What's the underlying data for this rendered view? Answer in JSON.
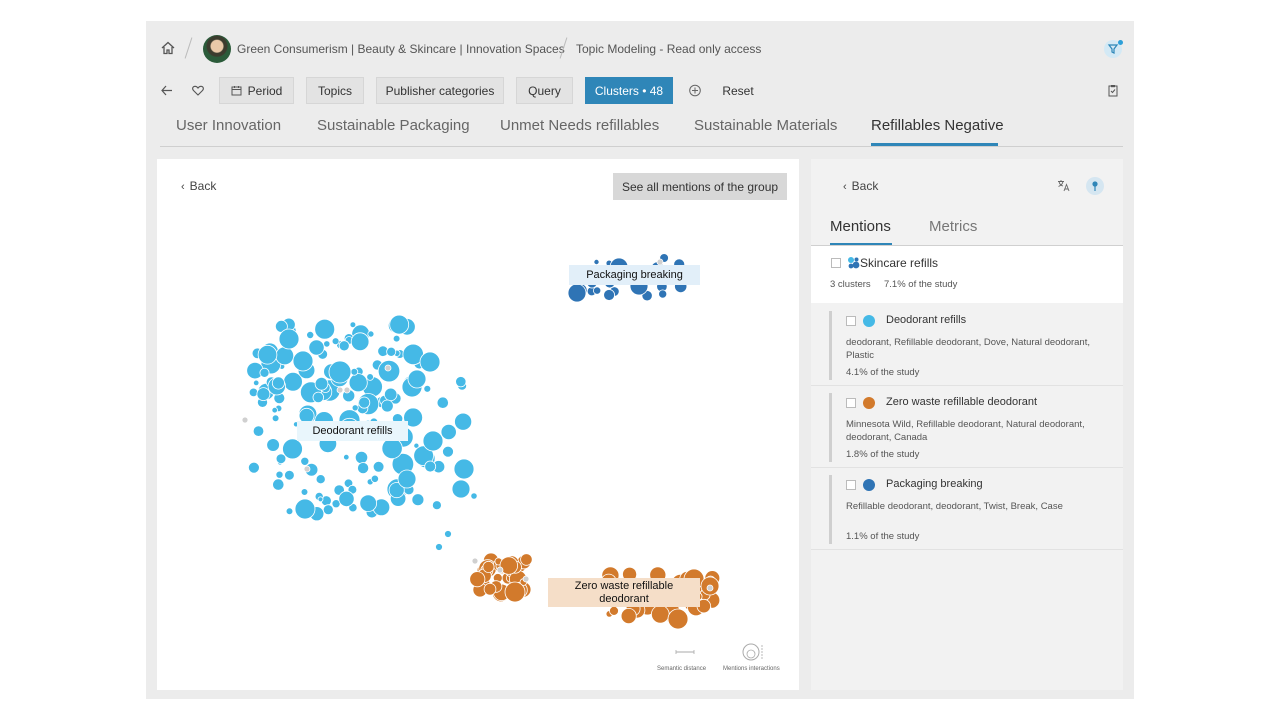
{
  "header": {
    "breadcrumb_project": "Green Consumerism | Beauty & Skincare | Innovation Spaces",
    "breadcrumb_view": "Topic Modeling - Read only access"
  },
  "toolbar": {
    "period": "Period",
    "topics": "Topics",
    "publisher_categories": "Publisher categories",
    "query": "Query",
    "clusters": "Clusters • 48",
    "reset": "Reset"
  },
  "tabs": [
    {
      "label": "User Innovation"
    },
    {
      "label": "Sustainable Packaging"
    },
    {
      "label": "Unmet Needs refillables"
    },
    {
      "label": "Sustainable Materials"
    },
    {
      "label": "Refillables Negative"
    }
  ],
  "map": {
    "back": "Back",
    "see_all": "See all mentions of the group",
    "labels": {
      "packaging": "Packaging breaking",
      "deodorant": "Deodorant refills",
      "zero_waste": "Zero waste refillable deodorant"
    },
    "legend": {
      "semantic_distance": "Semantic distance",
      "mentions_interactions": "Mentions interactions"
    },
    "colors": {
      "deodorant": "#45b9e6",
      "zero_waste": "#d27a2c",
      "packaging": "#2f74b5",
      "noise": "#d0d0d0"
    }
  },
  "side": {
    "back": "Back",
    "tabs": {
      "mentions": "Mentions",
      "metrics": "Metrics"
    },
    "group": {
      "title": "Skincare refills",
      "clusters": "3 clusters",
      "share": "7.1% of the study"
    },
    "clusters": [
      {
        "title": "Deodorant refills",
        "keywords": "deodorant, Refillable deodorant, Dove, Natural deodorant, Plastic",
        "share": "4.1% of the study",
        "color": "#45b9e6"
      },
      {
        "title": "Zero waste refillable deodorant",
        "keywords": "Minnesota Wild, Refillable deodorant, Natural deodorant, deodorant, Canada",
        "share": "1.8% of the study",
        "color": "#d27a2c"
      },
      {
        "title": "Packaging breaking",
        "keywords": "Refillable deodorant, deodorant, Twist, Break, Case",
        "share": "1.1% of the study",
        "color": "#2f74b5"
      }
    ]
  }
}
